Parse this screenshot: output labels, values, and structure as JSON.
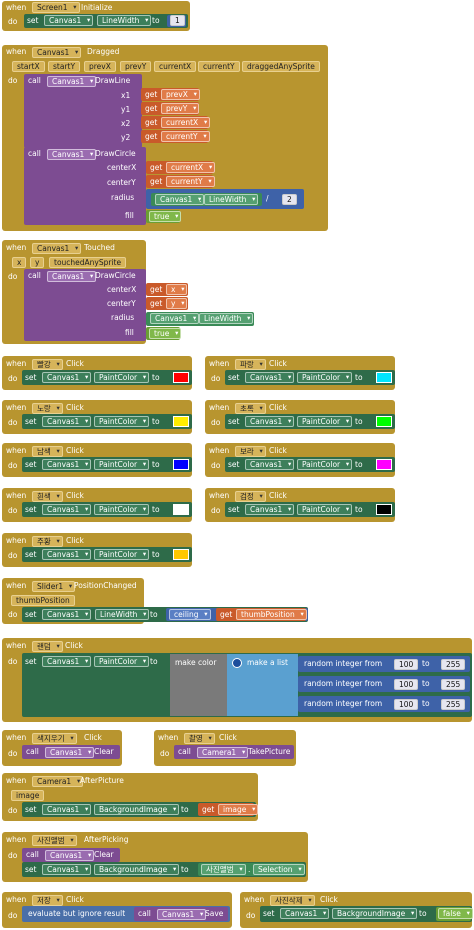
{
  "kw": {
    "when": "when",
    "do": "do",
    "set": "set",
    "to": "to",
    "call": "call",
    "get": "get"
  },
  "screen_init": {
    "component": "Screen1",
    "event": "Initialize",
    "target": "Canvas1",
    "prop": "LineWidth",
    "value": "1"
  },
  "dragged": {
    "component": "Canvas1",
    "event": "Dragged",
    "params": [
      "startX",
      "startY",
      "prevX",
      "prevY",
      "currentX",
      "currentY",
      "draggedAnySprite"
    ],
    "drawline": {
      "method": "DrawLine",
      "args": [
        {
          "label": "x1",
          "value": "prevX"
        },
        {
          "label": "y1",
          "value": "prevY"
        },
        {
          "label": "x2",
          "value": "currentX"
        },
        {
          "label": "y2",
          "value": "currentY"
        }
      ]
    },
    "drawcircle": {
      "method": "DrawCircle",
      "centerX_label": "centerX",
      "centerX": "currentX",
      "centerY_label": "centerY",
      "centerY": "currentY",
      "radius_label": "radius",
      "radius_prop": "LineWidth",
      "op": "/",
      "divisor": "2",
      "fill_label": "fill",
      "fill": "true"
    }
  },
  "touched": {
    "component": "Canvas1",
    "event": "Touched",
    "params": [
      "x",
      "y",
      "touchedAnySprite"
    ],
    "method": "DrawCircle",
    "centerX_label": "centerX",
    "centerX": "x",
    "centerY_label": "centerY",
    "centerY": "y",
    "radius_label": "radius",
    "radius_prop": "LineWidth",
    "fill_label": "fill",
    "fill": "true"
  },
  "color_buttons": [
    {
      "name": "빨강",
      "color": "#ff0000"
    },
    {
      "name": "파랑",
      "color": "#00e5ff"
    },
    {
      "name": "노랑",
      "color": "#ffee00"
    },
    {
      "name": "초록",
      "color": "#00ff00"
    },
    {
      "name": "남색",
      "color": "#0000ff"
    },
    {
      "name": "보라",
      "color": "#ff00ff"
    },
    {
      "name": "흰색",
      "color": "#ffffff"
    },
    {
      "name": "검정",
      "color": "#000000"
    },
    {
      "name": "주황",
      "color": "#ffc800"
    }
  ],
  "click_label": "Click",
  "paint_prop": "PaintColor",
  "canvas": "Canvas1",
  "slider": {
    "component": "Slider1",
    "event": "PositionChanged",
    "param": "thumbPosition",
    "prop": "LineWidth",
    "func": "ceiling",
    "get": "thumbPosition"
  },
  "random": {
    "component": "랜덤",
    "event": "Click",
    "prop": "PaintColor",
    "make_color": "make color",
    "make_list": "make a list",
    "rows": [
      {
        "label": "random integer from",
        "from": "100",
        "to": "255"
      },
      {
        "label": "random integer from",
        "from": "100",
        "to": "255"
      },
      {
        "label": "random integer from",
        "from": "100",
        "to": "255"
      }
    ]
  },
  "clear_btn": {
    "component": "색지우기",
    "event": "Click",
    "target": "Canvas1",
    "method": "Clear"
  },
  "photo_btn": {
    "component": "촬영",
    "event": "Click",
    "target": "Camera1",
    "method": "TakePicture"
  },
  "after_picture": {
    "component": "Camera1",
    "event": "AfterPicture",
    "param": "image",
    "prop": "BackgroundImage",
    "get": "image"
  },
  "after_picking": {
    "component": "사진앨범",
    "event": "AfterPicking",
    "clear_target": "Canvas1",
    "clear_method": "Clear",
    "prop": "BackgroundImage",
    "src": "사진앨범",
    "src_prop": "Selection"
  },
  "save_btn": {
    "component": "저장",
    "event": "Click",
    "evaluate": "evaluate but ignore result",
    "target": "Canvas1",
    "method": "Save"
  },
  "delete_btn": {
    "component": "사진삭제",
    "event": "Click",
    "prop": "BackgroundImage",
    "value": "false"
  }
}
